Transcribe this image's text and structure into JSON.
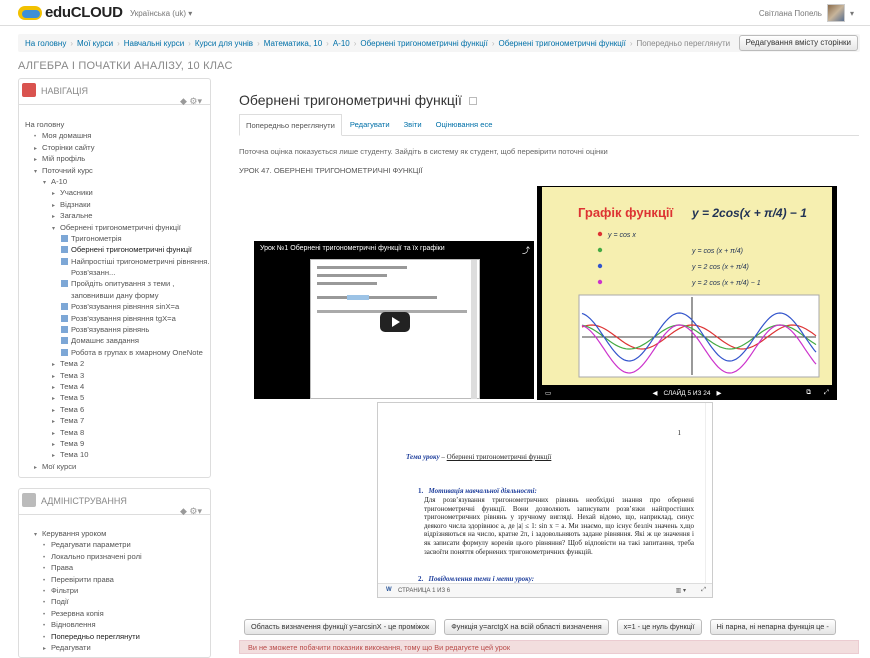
{
  "header": {
    "logo_text": "eduCLOUD",
    "language": "Українська (uk) ▾",
    "user_name": "Світлана Попель"
  },
  "breadcrumb": [
    "На головну",
    "Мої курси",
    "Навчальні курси",
    "Курси для учнів",
    "Математика, 10",
    "А-10",
    "Обернені тригонометричні функції",
    "Обернені тригонометричні функції",
    "Попередньо переглянути"
  ],
  "edit_button": "Редагування вмісту сторінки",
  "course_title": "АЛГЕБРА І ПОЧАТКИ АНАЛІЗУ, 10 КЛАС",
  "navigation": {
    "title": "НАВІГАЦІЯ",
    "items": [
      {
        "label": "На головну",
        "level": 0,
        "mk": ""
      },
      {
        "label": "Моя домашня",
        "level": 1,
        "mk": "•"
      },
      {
        "label": "Сторінки сайту",
        "level": 1,
        "mk": "▸"
      },
      {
        "label": "Мій профіль",
        "level": 1,
        "mk": "▸"
      },
      {
        "label": "Поточний курс",
        "level": 1,
        "mk": "▾"
      },
      {
        "label": "А-10",
        "level": 2,
        "mk": "▾"
      },
      {
        "label": "Учасники",
        "level": 3,
        "mk": "▸"
      },
      {
        "label": "Відзнаки",
        "level": 3,
        "mk": "▸"
      },
      {
        "label": "Загальне",
        "level": 3,
        "mk": "▸"
      },
      {
        "label": "Обернені тригонометричні функції",
        "level": 3,
        "mk": "▾"
      },
      {
        "label": "Тригонометрія",
        "level": 4,
        "mk": "sq"
      },
      {
        "label": "Обернені тригонометричні функції",
        "level": 4,
        "mk": "sq",
        "bold": true
      },
      {
        "label": "Найпростіші тригонометричні рівняння.",
        "level": 4,
        "mk": "sq"
      },
      {
        "label": "Розв'язанн...",
        "level": 4,
        "mk": ""
      },
      {
        "label": "Пройдіть опитування з теми ,",
        "level": 4,
        "mk": "sq"
      },
      {
        "label": "заповнивши дану форму",
        "level": 4,
        "mk": ""
      },
      {
        "label": "Розв'язування рівняння sinX=a",
        "level": 4,
        "mk": "sq"
      },
      {
        "label": "Розв'язування рівняння tgX=a",
        "level": 4,
        "mk": "sq"
      },
      {
        "label": "Розв'язування рівнянь",
        "level": 4,
        "mk": "sq"
      },
      {
        "label": "Домашнє завдання",
        "level": 4,
        "mk": "sq"
      },
      {
        "label": "Робота в групах в хмарному OneNote",
        "level": 4,
        "mk": "sq"
      },
      {
        "label": "Тема 2",
        "level": 3,
        "mk": "▸"
      },
      {
        "label": "Тема 3",
        "level": 3,
        "mk": "▸"
      },
      {
        "label": "Тема 4",
        "level": 3,
        "mk": "▸"
      },
      {
        "label": "Тема 5",
        "level": 3,
        "mk": "▸"
      },
      {
        "label": "Тема 6",
        "level": 3,
        "mk": "▸"
      },
      {
        "label": "Тема 7",
        "level": 3,
        "mk": "▸"
      },
      {
        "label": "Тема 8",
        "level": 3,
        "mk": "▸"
      },
      {
        "label": "Тема 9",
        "level": 3,
        "mk": "▸"
      },
      {
        "label": "Тема 10",
        "level": 3,
        "mk": "▸"
      },
      {
        "label": "Мої курси",
        "level": 1,
        "mk": "▸"
      }
    ]
  },
  "administration": {
    "title": "АДМІНІСТРУВАННЯ",
    "items": [
      {
        "label": "Керування уроком",
        "level": 1,
        "mk": "▾"
      },
      {
        "label": "Редагувати параметри",
        "level": 2,
        "mk": "•"
      },
      {
        "label": "Локально призначені ролі",
        "level": 2,
        "mk": "•"
      },
      {
        "label": "Права",
        "level": 2,
        "mk": "•"
      },
      {
        "label": "Перевірити права",
        "level": 2,
        "mk": "•"
      },
      {
        "label": "Фільтри",
        "level": 2,
        "mk": "•"
      },
      {
        "label": "Події",
        "level": 2,
        "mk": "•"
      },
      {
        "label": "Резервна копія",
        "level": 2,
        "mk": "•"
      },
      {
        "label": "Відновлення",
        "level": 2,
        "mk": "•"
      },
      {
        "label": "Попередньо переглянути",
        "level": 2,
        "mk": "•",
        "bold": true
      },
      {
        "label": "Редагувати",
        "level": 2,
        "mk": "▸"
      }
    ]
  },
  "page_title": "Обернені тригонометричні функції",
  "tabs": [
    {
      "label": "Попередньо переглянути",
      "active": true
    },
    {
      "label": "Редагувати",
      "active": false
    },
    {
      "label": "Звіти",
      "active": false
    },
    {
      "label": "Оцінювання есе",
      "active": false
    }
  ],
  "notice": "Поточна оцінка показується лише студенту. Зайдіть в систему як студент, щоб перевірити поточні оцінки",
  "lesson_heading": "УРОК 47. ОБЕРНЕНІ ТРИГОНОМЕТРИЧНІ ФУНКЦІЇ",
  "video": {
    "title": "Урок №1 Обернені тригонометричні функції та їх графіки"
  },
  "slide": {
    "title": "Графік  функції",
    "formula": "y = 2cos(x + π/4) − 1",
    "legend": [
      "y = cos x",
      "y = cos (x + π/4)",
      "y = 2 cos (x + π/4)",
      "y = 2 cos (x + π/4) − 1"
    ],
    "legend_colors": [
      "#d33",
      "#4a4",
      "#35c",
      "#c3c"
    ],
    "counter": "СЛАЙД 5 ИЗ 24"
  },
  "document": {
    "page_number": "1",
    "topic_label": "Тема уроку",
    "topic_text": "Обернені тригонометричні функції",
    "section1_title": "Мотивація навчальної діяльності:",
    "section1_text": "Для розв’язування тригонометричних рівнянь необхідні знання про обернені тригонометричні функції. Вони дозволяють записувати розв’язки найпростіших тригонометричних рівнянь у зручному вигляді. Нехай відомо, що, наприклад, синус деякого числа здорівнює a, де |a| ≤ 1: sin x = a. Ми знаємо, що існує безліч значень x,що відрізняються на число, кратне 2π, і задовольняють задане рівняння. Які ж це значення і як записати формулу коренів цього рівняння? Щоб відповісти на такі запитання, треба засвоїти поняття обернених тригонометричних функцій.",
    "section2_title": "Повідомлення теми і мети уроку:",
    "footer": "СТРАНИЦА 1 ИЗ 6"
  },
  "buttons": [
    "Область визначення функції y=arcsinX - це проміжок",
    "Функція y=arctgX  на всій області визначення",
    "x=1 - це нуль функції",
    "Ні парна, ні непарна функція це -"
  ],
  "alert": "Ви не зможете побачити показник виконання, тому що Ви редагуєте цей урок"
}
